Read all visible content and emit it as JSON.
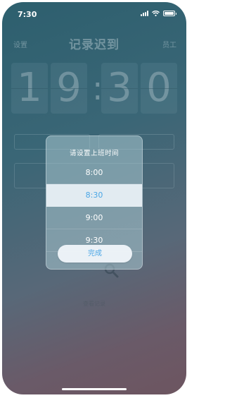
{
  "status_bar": {
    "time": "7:30"
  },
  "nav": {
    "left": "设置",
    "title": "记录迟到",
    "right": "员工"
  },
  "clock": {
    "digits": [
      "1",
      "9",
      "3",
      "0"
    ],
    "separator": ":"
  },
  "dialog": {
    "title": "请设置上班时间",
    "options": [
      "8:00",
      "8:30",
      "9:00",
      "9:30"
    ],
    "selected": "8:30",
    "done_label": "完成"
  },
  "search": {
    "label": "查看记录",
    "icon": "search-icon"
  },
  "colors": {
    "accent": "#4aa6e6",
    "bg_top": "#2d5f6e",
    "bg_bottom": "#6d5560"
  }
}
